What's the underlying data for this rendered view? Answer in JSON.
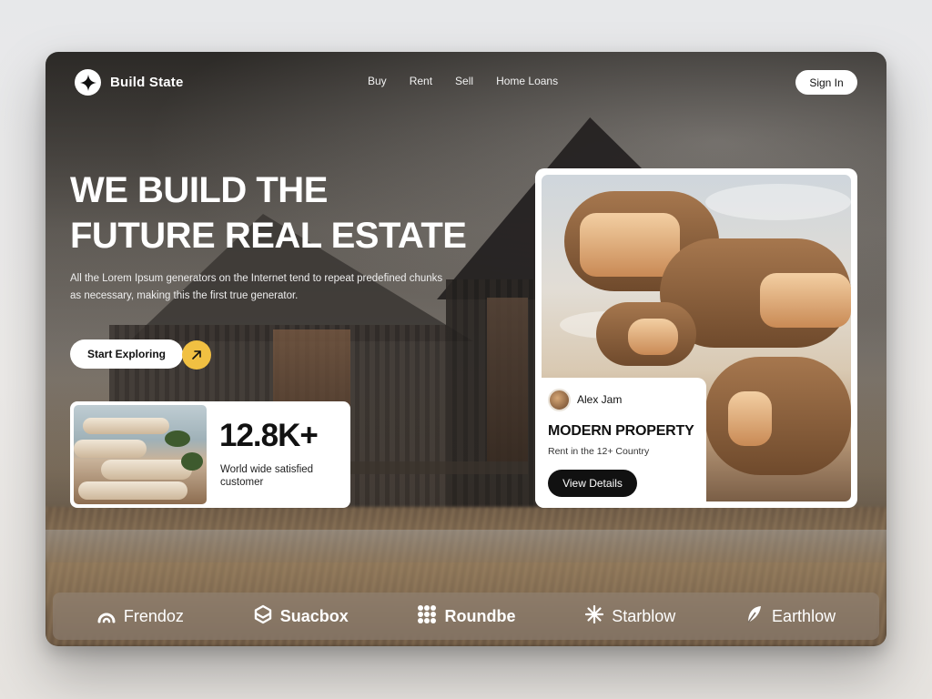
{
  "brand": {
    "name": "Build State",
    "icon": "sparkle-icon"
  },
  "nav": {
    "items": [
      {
        "label": "Buy"
      },
      {
        "label": "Rent"
      },
      {
        "label": "Sell"
      },
      {
        "label": "Home Loans"
      }
    ],
    "signin_label": "Sign In"
  },
  "hero": {
    "title_line1": "WE BUILD THE",
    "title_line2": "FUTURE REAL ESTATE",
    "description": "All the Lorem Ipsum generators on the Internet tend to repeat predefined chunks as necessary, making this the first true generator.",
    "cta_label": "Start Exploring",
    "cta_icon": "arrow-up-right-icon",
    "accent_color": "#F1C042"
  },
  "stat": {
    "value": "12.8K+",
    "label": "World wide satisfied customer"
  },
  "property": {
    "agent_name": "Alex Jam",
    "title": "MODERN PROPERTY",
    "subtitle": "Rent in the 12+ Country",
    "button_label": "View Details"
  },
  "partners": [
    {
      "name": "Frendoz",
      "icon": "arc-icon"
    },
    {
      "name": "Suacbox",
      "icon": "cube-icon"
    },
    {
      "name": "Roundbe",
      "icon": "dots-grid-icon"
    },
    {
      "name": "Starblow",
      "icon": "star-burst-icon"
    },
    {
      "name": "Earthlow",
      "icon": "leaf-icon"
    }
  ]
}
